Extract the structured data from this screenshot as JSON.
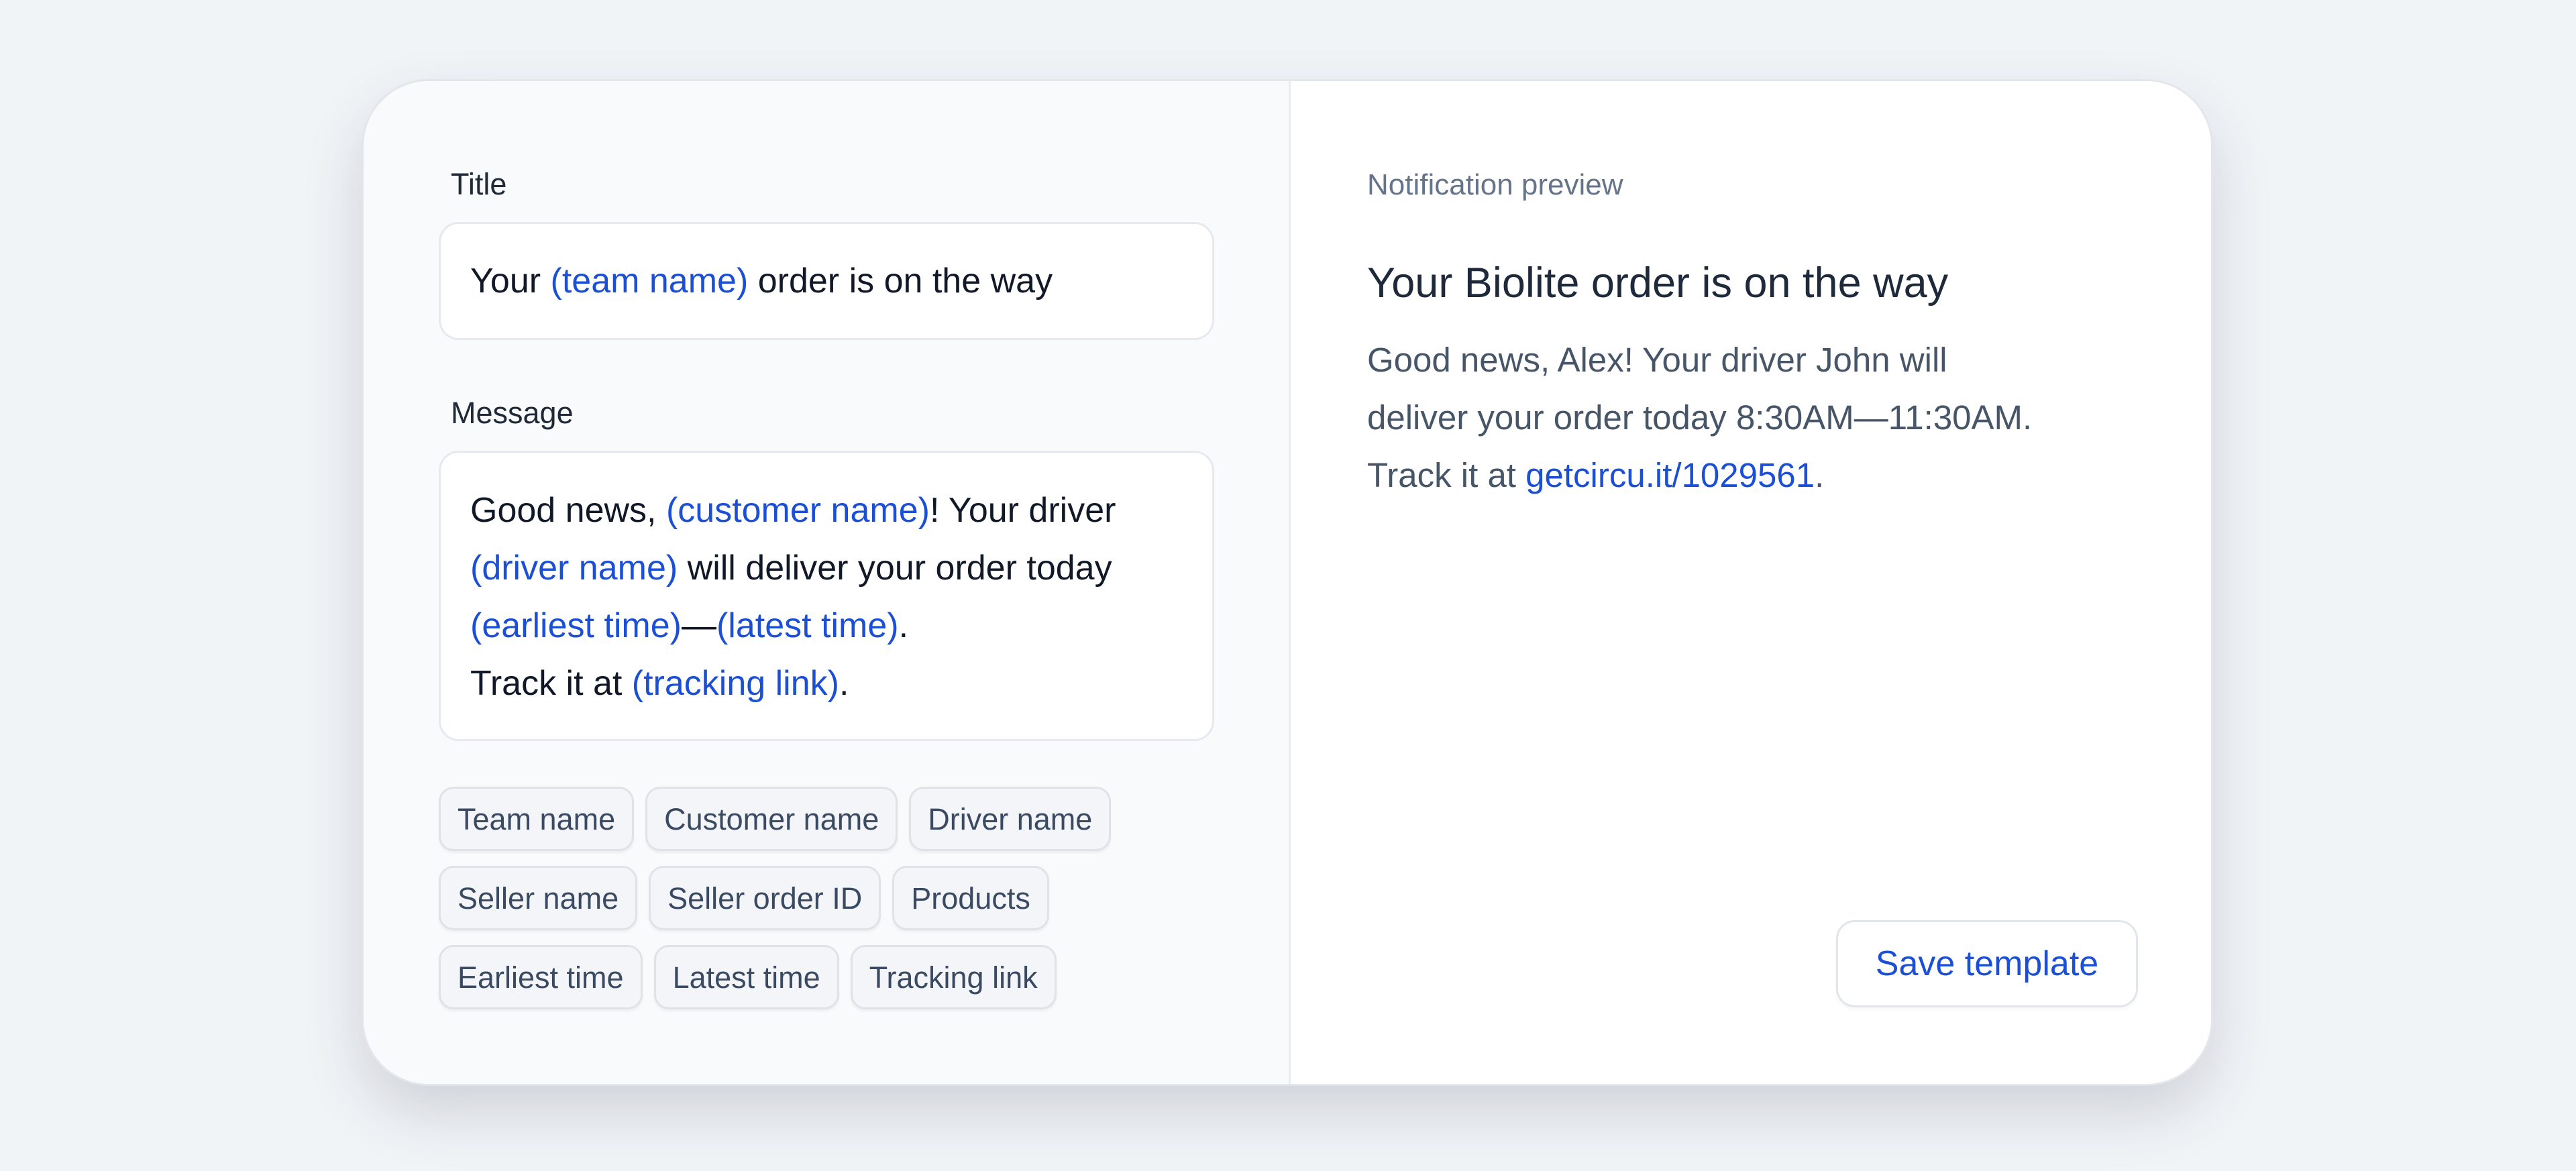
{
  "editor": {
    "title_label": "Title",
    "title_value": {
      "before": "Your ",
      "var": "(team name)",
      "after": " order is on the way"
    },
    "message_label": "Message",
    "message_lines": [
      {
        "p1": "Good news, ",
        "v1": "(customer name)",
        "p2": "! Your driver"
      },
      {
        "v1": "(driver name)",
        "p2": " will deliver your order today"
      },
      {
        "v1": "(earliest time)",
        "p2": "—",
        "v2": "(latest time)",
        "p3": "."
      },
      {
        "p1": "Track it at ",
        "v1": "(tracking link)",
        "p2": "."
      }
    ],
    "chips": [
      [
        "Team name",
        "Customer name",
        "Driver name"
      ],
      [
        "Seller name",
        "Seller order ID",
        "Products"
      ],
      [
        "Earliest time",
        "Latest time",
        "Tracking link"
      ]
    ]
  },
  "preview": {
    "label": "Notification preview",
    "title": "Your Biolite order is on the way",
    "body_lines": [
      "Good news, Alex! Your driver John will",
      "deliver your order today 8:30AM—11:30AM."
    ],
    "track_prefix": "Track it at ",
    "track_link": "getcircu.it/1029561",
    "track_suffix": "."
  },
  "actions": {
    "save_label": "Save template"
  },
  "colors": {
    "accent": "#1a4fd6",
    "background": "#f1f4f7",
    "panel": "#f8fafc"
  }
}
